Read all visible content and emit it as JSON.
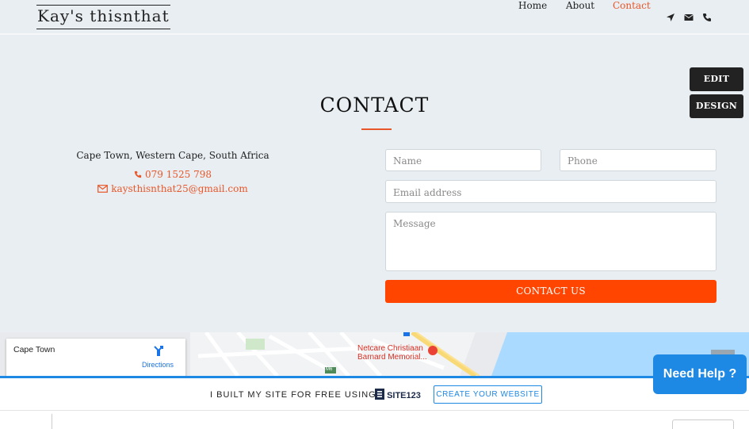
{
  "header": {
    "logo": "Kay's thisnthat",
    "nav": [
      {
        "label": "Home",
        "active": false
      },
      {
        "label": "About",
        "active": false
      },
      {
        "label": "Contact",
        "active": true
      }
    ],
    "nav_icons": [
      "location-arrow-icon",
      "envelope-icon",
      "phone-icon"
    ]
  },
  "admin": {
    "edit_label": "EDIT",
    "design_label": "DESIGN"
  },
  "contact": {
    "title": "CONTACT",
    "address": "Cape Town, Western Cape, South Africa",
    "phone": "079 1525 798",
    "email": "kaysthisnthat25@gmail.com",
    "form": {
      "name_placeholder": "Name",
      "phone_placeholder": "Phone",
      "email_placeholder": "Email address",
      "message_placeholder": "Message",
      "submit_label": "CONTACT US"
    }
  },
  "map": {
    "place": "Cape Town",
    "directions_label": "Directions",
    "poi_line1": "Netcare Christiaan",
    "poi_line2": "Barnard Memorial...",
    "road_badge": "M6"
  },
  "banner": {
    "text": "I BUILT MY SITE FOR FREE USING",
    "brand": "SITE123",
    "cta": "CREATE YOUR WEBSITE"
  },
  "help": {
    "label": "Need Help ?"
  },
  "colors": {
    "accent": "#e8572a",
    "button": "#ff4500",
    "banner_blue": "#1e88e5",
    "background": "#e9eef2"
  }
}
